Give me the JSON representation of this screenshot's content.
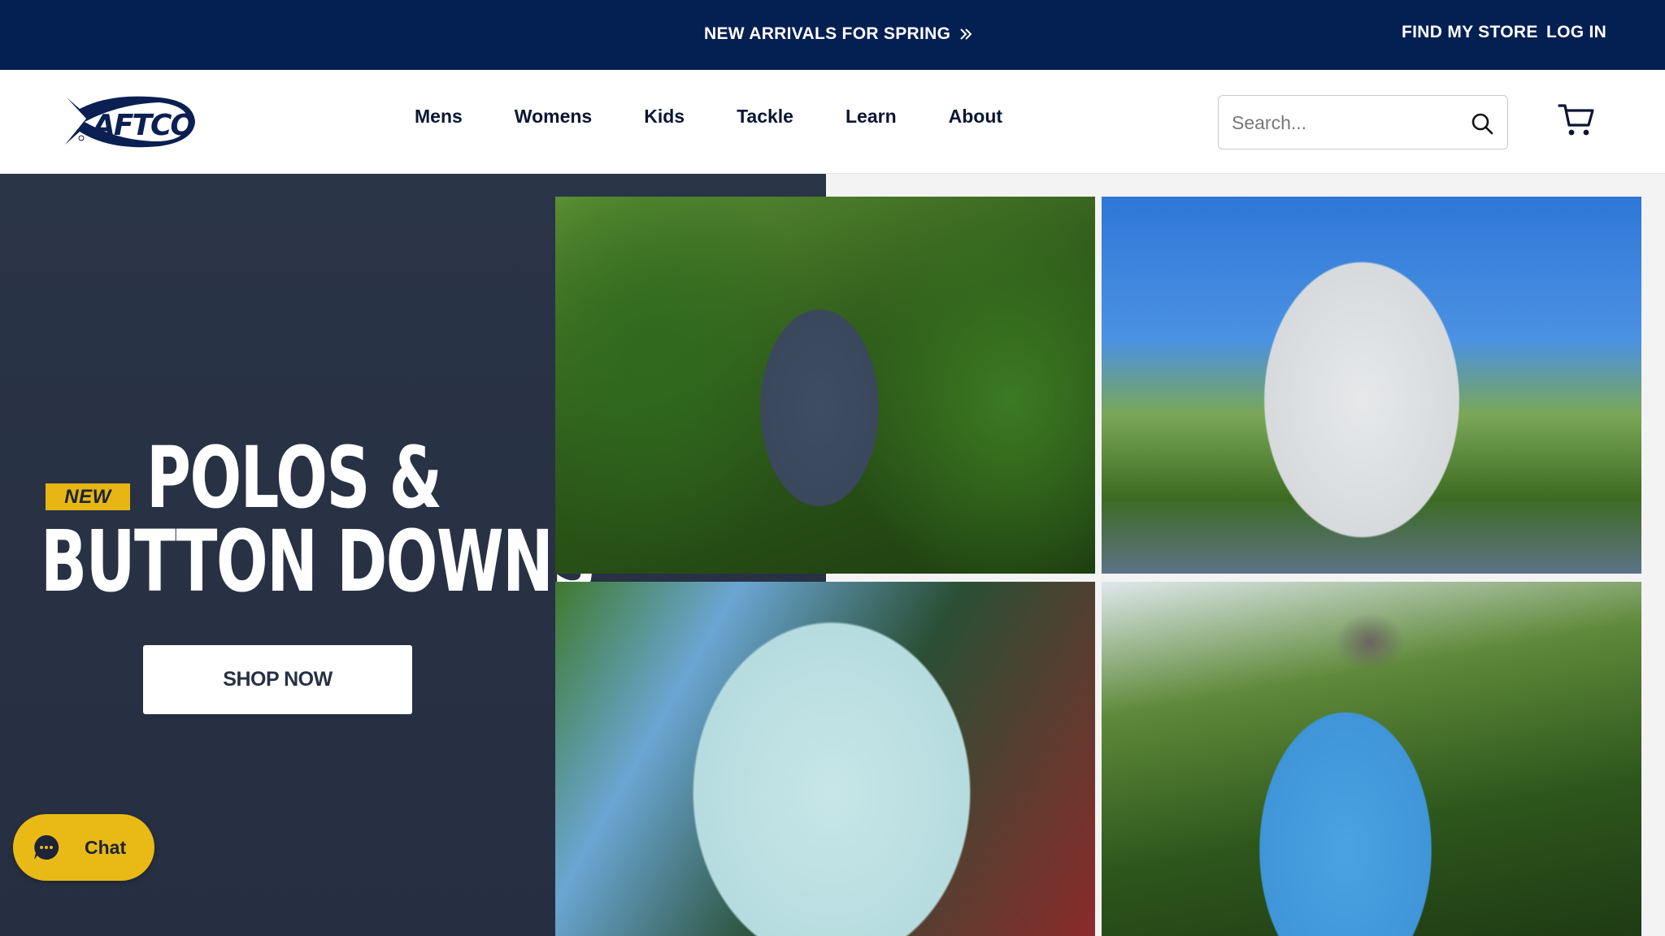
{
  "announcement": {
    "text": "NEW ARRIVALS FOR SPRING",
    "icon": "double-chevron-right-icon"
  },
  "utility_nav": {
    "find_store": "FIND MY STORE",
    "log_in": "LOG IN"
  },
  "header": {
    "logo_text": "AFTCO",
    "nav": [
      "Mens",
      "Womens",
      "Kids",
      "Tackle",
      "Learn",
      "About"
    ],
    "search_placeholder": "Search...",
    "search_icon": "search-icon",
    "cart_icon": "cart-icon"
  },
  "hero": {
    "badge": "NEW",
    "headline_line1": "POLOS &",
    "headline_line2": "BUTTON DOWNS",
    "cta": "SHOP NOW"
  },
  "chat": {
    "label": "Chat",
    "icon": "chat-bubble-icon"
  },
  "colors": {
    "navy": "#041f52",
    "hero_bg": "#283144",
    "accent_yellow": "#e8b614",
    "text_dark": "#0b1633"
  }
}
